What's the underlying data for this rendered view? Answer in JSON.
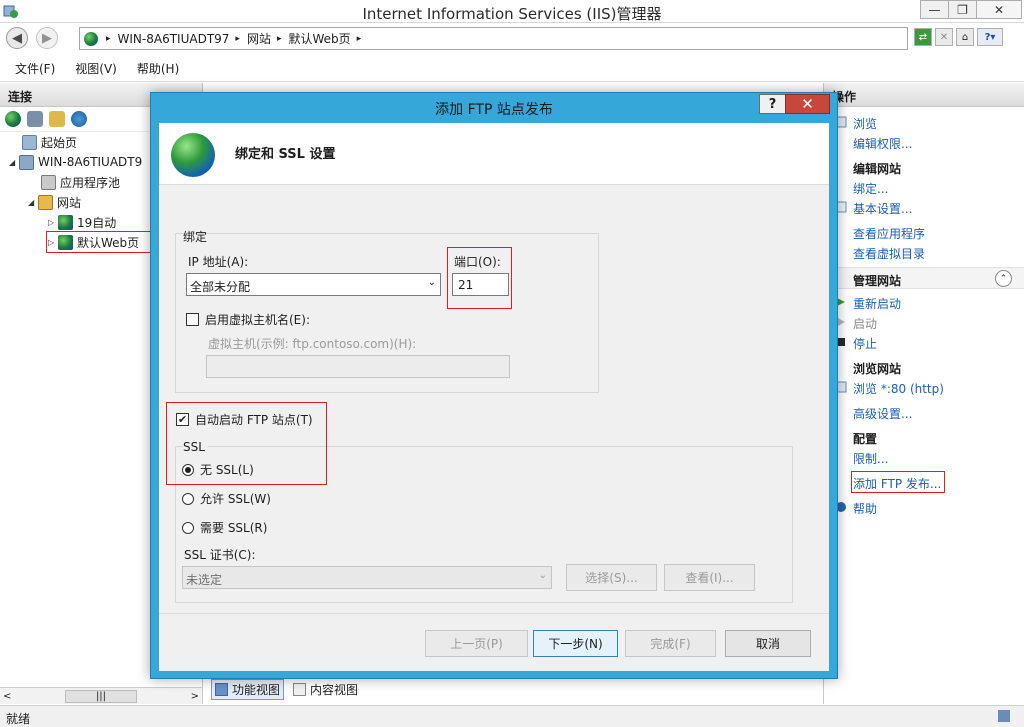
{
  "window": {
    "title": "Internet Information Services (IIS)管理器",
    "min_label": "—",
    "max_label": "❐",
    "close_label": "✕"
  },
  "address": {
    "crumbs": [
      "WIN-8A6TIUADT97",
      "网站",
      "默认Web页"
    ],
    "sep": "▸"
  },
  "menu": {
    "items": [
      "文件(F)",
      "视图(V)",
      "帮助(H)"
    ]
  },
  "connections": {
    "header": "连接",
    "tree": {
      "start_page": "起始页",
      "server": "WIN-8A6TIUADT9",
      "app_pools": "应用程序池",
      "sites": "网站",
      "site1": "19自动",
      "site2": "默认Web页"
    }
  },
  "views": {
    "features": "功能视图",
    "content": "内容视图"
  },
  "actions": {
    "header": "操作",
    "browse": "浏览",
    "edit_perms": "编辑权限...",
    "edit_site_title": "编辑网站",
    "bindings": "绑定...",
    "basic_settings": "基本设置...",
    "view_apps": "查看应用程序",
    "view_vdirs": "查看虚拟目录",
    "manage_site_title": "管理网站",
    "restart": "重新启动",
    "start": "启动",
    "stop": "停止",
    "browse_site_title": "浏览网站",
    "browse_80": "浏览 *:80 (http)",
    "advanced": "高级设置...",
    "config_title": "配置",
    "limits": "限制...",
    "add_ftp": "添加 FTP 发布...",
    "help": "帮助"
  },
  "status": {
    "text": "就绪"
  },
  "dialog": {
    "title": "添加 FTP 站点发布",
    "help_label": "?",
    "close_label": "✕",
    "heading": "绑定和 SSL 设置",
    "binding_group": "绑定",
    "ip_label": "IP 地址(A):",
    "ip_value": "全部未分配",
    "port_label": "端口(O):",
    "port_value": "21",
    "vhost_check_label": "启用虚拟主机名(E):",
    "vhost_label": "虚拟主机(示例: ftp.contoso.com)(H):",
    "vhost_value": "",
    "autostart_label": "自动启动 FTP 站点(T)",
    "autostart_checked": true,
    "ssl_group": "SSL",
    "ssl_none": "无 SSL(L)",
    "ssl_allow": "允许 SSL(W)",
    "ssl_require": "需要 SSL(R)",
    "ssl_selected": "none",
    "cert_label": "SSL 证书(C):",
    "cert_value": "未选定",
    "select_btn": "选择(S)...",
    "view_btn": "查看(I)...",
    "prev_btn": "上一页(P)",
    "next_btn": "下一步(N)",
    "finish_btn": "完成(F)",
    "cancel_btn": "取消"
  },
  "colors": {
    "dialog_frame": "#35a7d8",
    "link": "#1a5fb4",
    "highlight_box": "#e02020",
    "close_button": "#c7473c"
  }
}
